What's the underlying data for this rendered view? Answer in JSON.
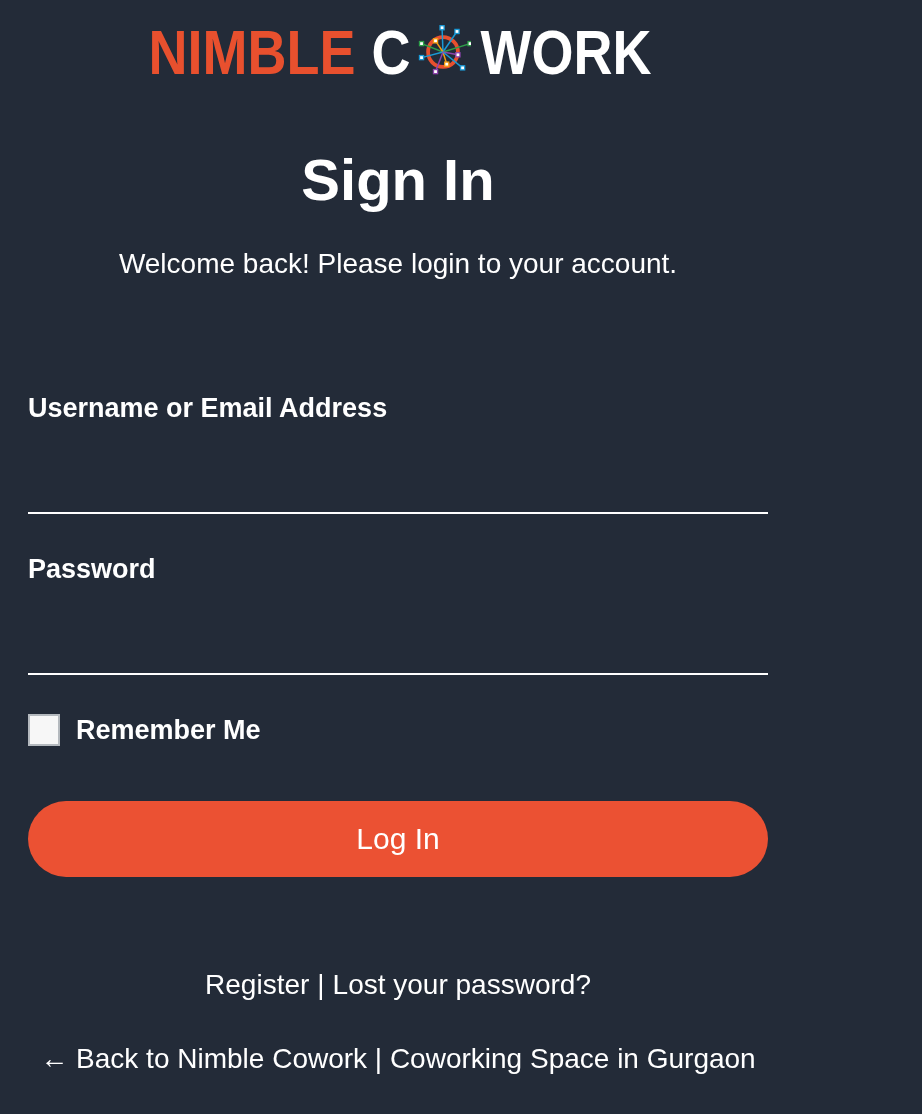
{
  "logo": {
    "first_word": "NIMBLE",
    "second_word_start": "C",
    "second_word_end": "WORK"
  },
  "title": "Sign In",
  "subtitle": "Welcome back! Please login to your account.",
  "fields": [
    {
      "label": "Username or Email Address"
    },
    {
      "label": "Password"
    }
  ],
  "remember": {
    "label": "Remember Me",
    "checked": false
  },
  "submit": {
    "label": "Log In"
  },
  "links": [
    {
      "label": "Register"
    },
    {
      "label": "Lost your password?"
    }
  ],
  "separator": "|",
  "back_link": "← Back to Nimble Cowork | Coworking Space in Gurgaon"
}
